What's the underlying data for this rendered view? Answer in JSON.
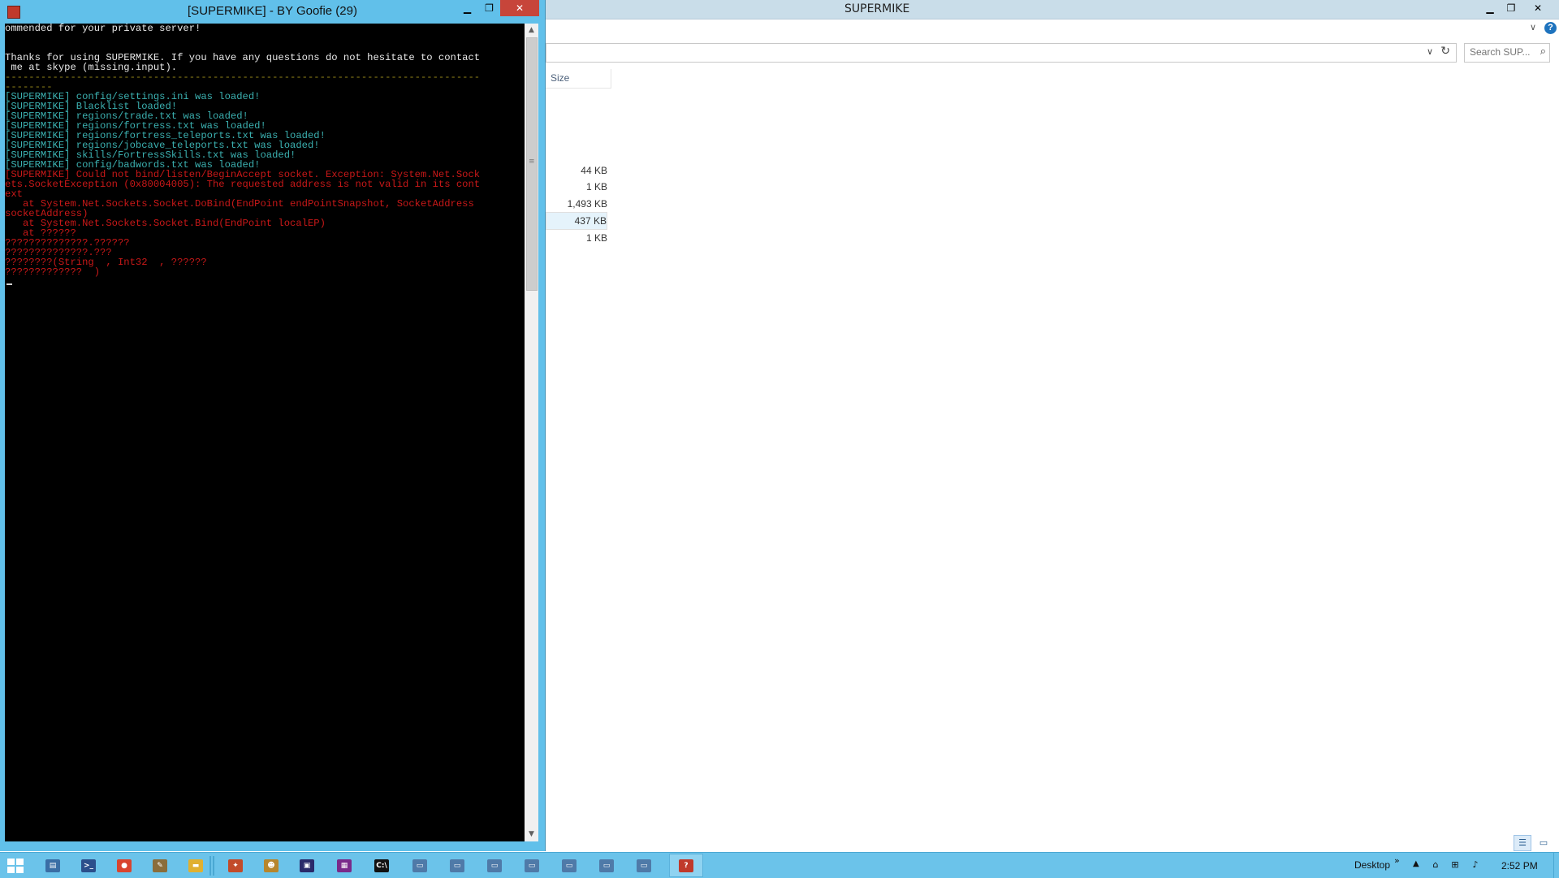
{
  "explorer": {
    "title": "SUPERMIKE",
    "minimize": "▁",
    "restore": "❐",
    "close": "✕",
    "ribbon_expand": "∨",
    "help": "?",
    "address_dropdown": "∨",
    "refresh": "↻",
    "search_placeholder": "Search SUP...",
    "search_icon": "⌕",
    "column_size": "Size",
    "file_sizes": [
      "44 KB",
      "1 KB",
      "1,493 KB",
      "437 KB",
      "1 KB"
    ],
    "details_view": "☰",
    "tiles_view": "▭"
  },
  "console": {
    "title": "[SUPERMIKE] - BY Goofie (29)",
    "minimize": "▁",
    "restore": "❐",
    "close": "✕",
    "scroll_up": "▲",
    "scroll_down": "▼",
    "lines": [
      {
        "text": "ommended for your private server!",
        "color": "white"
      },
      {
        "text": "",
        "color": "white"
      },
      {
        "text": "",
        "color": "white"
      },
      {
        "text": "Thanks for using SUPERMIKE. If you have any questions do not hesitate to contact",
        "color": "white"
      },
      {
        "text": " me at skype (missing.input).",
        "color": "white"
      },
      {
        "text": "--------------------------------------------------------------------------------",
        "color": "yellow"
      },
      {
        "text": "--------",
        "color": "yellow"
      },
      {
        "text": "[SUPERMIKE] config/settings.ini was loaded!",
        "color": "cyan"
      },
      {
        "text": "[SUPERMIKE] Blacklist loaded!",
        "color": "cyan"
      },
      {
        "text": "[SUPERMIKE] regions/trade.txt was loaded!",
        "color": "cyan"
      },
      {
        "text": "[SUPERMIKE] regions/fortress.txt was loaded!",
        "color": "cyan"
      },
      {
        "text": "[SUPERMIKE] regions/fortress_teleports.txt was loaded!",
        "color": "cyan"
      },
      {
        "text": "[SUPERMIKE] regions/jobcave_teleports.txt was loaded!",
        "color": "cyan"
      },
      {
        "text": "[SUPERMIKE] skills/FortressSkills.txt was loaded!",
        "color": "cyan"
      },
      {
        "text": "[SUPERMIKE] config/badwords.txt was loaded!",
        "color": "cyan"
      },
      {
        "text": "[SUPERMIKE] Could not bind/listen/BeginAccept socket. Exception: System.Net.Sock",
        "color": "red"
      },
      {
        "text": "ets.SocketException (0x80004005): The requested address is not valid in its cont",
        "color": "red"
      },
      {
        "text": "ext",
        "color": "red"
      },
      {
        "text": "   at System.Net.Sockets.Socket.DoBind(EndPoint endPointSnapshot, SocketAddress",
        "color": "red"
      },
      {
        "text": "socketAddress)",
        "color": "red"
      },
      {
        "text": "   at System.Net.Sockets.Socket.Bind(EndPoint localEP)",
        "color": "red"
      },
      {
        "text": "   at ??????",
        "color": "red"
      },
      {
        "text": "??????????????.??????",
        "color": "red"
      },
      {
        "text": "??????????????.???",
        "color": "red"
      },
      {
        "text": "????????(String  , Int32  , ??????",
        "color": "red"
      },
      {
        "text": "?????????????  )",
        "color": "red"
      }
    ]
  },
  "taskbar": {
    "desktop_label": "Desktop",
    "overflow_chevron": "»",
    "tray_up": "▲",
    "clock": "2:52 PM",
    "items": [
      {
        "name": "server-manager-icon",
        "glyph": "▤",
        "color": "#3a6ea5"
      },
      {
        "name": "powershell-icon",
        "glyph": ">_",
        "color": "#2b4f8c"
      },
      {
        "name": "chrome-icon",
        "glyph": "●",
        "color": "#d9442f"
      },
      {
        "name": "tool-icon",
        "glyph": "✎",
        "color": "#8a6d3b"
      },
      {
        "name": "folder-icon",
        "glyph": "▬",
        "color": "#e0b030"
      },
      {
        "name": "network-icon",
        "glyph": "✦",
        "color": "#c24b2a"
      },
      {
        "name": "character-icon",
        "glyph": "☻",
        "color": "#b7862c"
      },
      {
        "name": "monitor-icon",
        "glyph": "▣",
        "color": "#2a2a6a"
      },
      {
        "name": "archive-icon",
        "glyph": "▦",
        "color": "#7a2a8a"
      },
      {
        "name": "cmd-icon",
        "glyph": "C:\\",
        "color": "#111111"
      },
      {
        "name": "window-icon",
        "glyph": "▭",
        "color": "#4f7aa8"
      },
      {
        "name": "window-icon",
        "glyph": "▭",
        "color": "#4f7aa8"
      },
      {
        "name": "window-icon",
        "glyph": "▭",
        "color": "#4f7aa8"
      },
      {
        "name": "window-icon",
        "glyph": "▭",
        "color": "#4f7aa8"
      },
      {
        "name": "window-icon",
        "glyph": "▭",
        "color": "#4f7aa8"
      },
      {
        "name": "window-icon",
        "glyph": "▭",
        "color": "#4f7aa8"
      },
      {
        "name": "window-icon",
        "glyph": "▭",
        "color": "#4f7aa8"
      },
      {
        "name": "supermike-icon",
        "glyph": "?",
        "color": "#c0392b"
      }
    ],
    "tray": [
      {
        "name": "network-tray-icon",
        "glyph": "⌂"
      },
      {
        "name": "lan-tray-icon",
        "glyph": "⊞"
      },
      {
        "name": "volume-tray-icon",
        "glyph": "♪"
      }
    ]
  },
  "colors": {
    "accent": "#6bc3ea",
    "console_bg": "#000000",
    "console_white": "#e8e8e8",
    "console_cyan": "#3bb0b0",
    "console_red": "#c81818",
    "console_yellow": "#9a8a1a"
  }
}
